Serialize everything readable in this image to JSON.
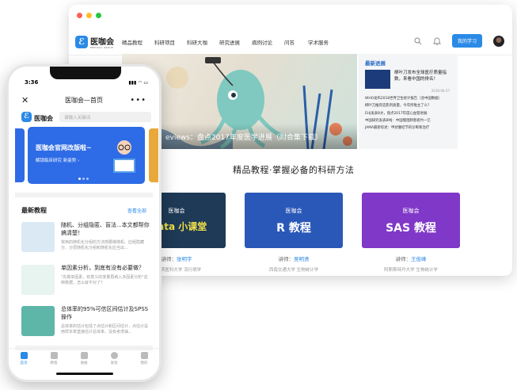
{
  "desktop": {
    "brand": {
      "name": "医咖会",
      "sub": "MEDICAL GROUP"
    },
    "nav": [
      "精品教程",
      "科研项目",
      "科研大咖",
      "研究进展",
      "病例讨论",
      "问答",
      "学术服务"
    ],
    "study_button": "我的学习",
    "banner_caption": "eviews：盘点2017年度医学进展（附合集下载）",
    "side": {
      "heading": "最新进展",
      "top_title": "柳叶刀发布全球医疗质量指数，来看中国的排名！",
      "top_date": "2018-06-27",
      "items": [
        "WHO发布2018世界卫生统计报告（含中国数据）",
        "柳叶刀推荐造影剂质量，今年所唯主了么？",
        "EHJ发表8文，盘点2017年度心血管进展",
        "中国研究发表BMJ：中国慢阻肺患者约一亿",
        "JAMA最新综述：甲状腺结节的诊断和治疗"
      ]
    },
    "section_title": "精品教程·掌握必备的科研方法",
    "courses": [
      {
        "logo": "医咖会",
        "name": "Stata 小课堂",
        "lecturer_label": "讲师：",
        "lecturer": "张明宇",
        "inst": "哈尔滨医科大学 流行病学",
        "color": "#1e3a56"
      },
      {
        "logo": "医咖会",
        "name": "R 教程",
        "lecturer_label": "讲师：",
        "lecturer": "吴明贤",
        "inst": "西南交通大学 生物统计学",
        "color": "#2a58b8"
      },
      {
        "logo": "医咖会",
        "name": "SAS 教程",
        "lecturer_label": "讲师：",
        "lecturer": "王俊峰",
        "inst": "阿斯斯特丹大学 生物统计学",
        "color": "#8038c8"
      }
    ]
  },
  "phone": {
    "time": "3:36",
    "title": "医咖会—首页",
    "search_placeholder": "请输入关键词",
    "banner_title": "医咖会官网改版啦~",
    "banner_sub": "解锁临床研究 新姿势 ›",
    "section": "最新教程",
    "see_all": "查看全部",
    "articles": [
      {
        "title": "随机、分组隐匿、盲法...本文都帮你搞清楚！",
        "desc": "常用的随机化分组的方法简要做随机、应组隐藏分、分层随机化分组和随机化应当出..."
      },
      {
        "title": "单因素分析，到底有没有必要做？",
        "desc": "\"先做单因素，有意义的变量再纳入多因素分析\"这种数据，怎么就不对了？"
      },
      {
        "title": "总体率的95%可信区间估计及SPSS操作",
        "desc": "总体率的估计包括了点估计和区间估计，点估计是用样本率直接估计总体率，没有考虑抽..."
      }
    ],
    "tabs": [
      "首页",
      "教程",
      "进展",
      "发现",
      "我的"
    ]
  }
}
